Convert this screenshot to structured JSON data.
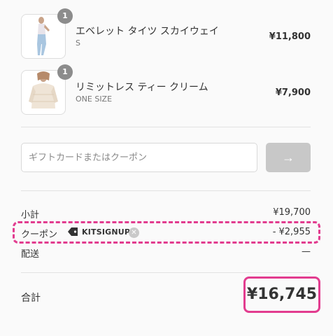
{
  "cart": {
    "items": [
      {
        "quantity": "1",
        "name": "エベレット タイツ スカイウェイ",
        "variant": "S",
        "price": "¥11,800"
      },
      {
        "quantity": "1",
        "name": "リミットレス ティー クリーム",
        "variant": "ONE SIZE",
        "price": "¥7,900"
      }
    ]
  },
  "discount_form": {
    "placeholder": "ギフトカードまたはクーポン",
    "apply_icon": "→"
  },
  "summary": {
    "subtotal_label": "小計",
    "subtotal_value": "¥19,700",
    "coupon_label": "クーポン",
    "coupon_code": "KITSIGNUP",
    "coupon_value": "- ¥2,955",
    "shipping_label": "配送",
    "shipping_value": "—",
    "total_label": "合計",
    "total_value": "¥16,745"
  },
  "colors": {
    "highlight": "#e23c8f",
    "apply_button": "#c8c8c8",
    "qty_badge": "#8c8c8c"
  },
  "icons": {
    "tag": "tag-icon",
    "remove": "close-circle-icon",
    "apply": "arrow-right-icon"
  }
}
